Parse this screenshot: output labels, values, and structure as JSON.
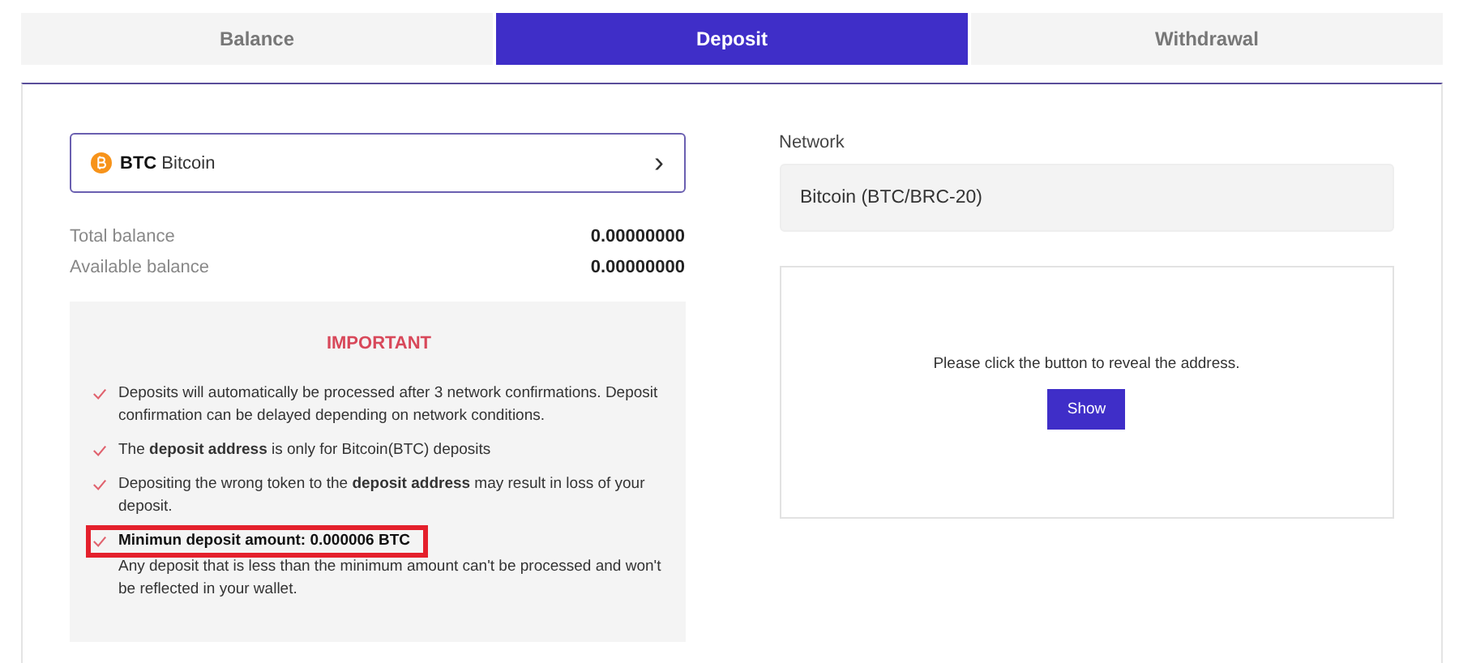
{
  "tabs": [
    {
      "label": "Balance",
      "selected": false
    },
    {
      "label": "Deposit",
      "selected": true
    },
    {
      "label": "Withdrawal",
      "selected": false
    }
  ],
  "coin_selector": {
    "symbol": "BTC",
    "name": "Bitcoin",
    "chevron": "›"
  },
  "balances": [
    {
      "label": "Total balance",
      "value": "0.00000000"
    },
    {
      "label": "Available balance",
      "value": "0.00000000"
    }
  ],
  "important": {
    "title": "IMPORTANT",
    "notes": [
      {
        "text": "Deposits will automatically be processed after 3 network confirmations. Deposit confirmation can be delayed depending on network conditions.",
        "highlighted": false
      },
      {
        "text": "The **deposit address** is only for Bitcoin(BTC) deposits",
        "highlighted": false
      },
      {
        "text": "Depositing the wrong token to the **deposit address** may result in loss of your deposit.",
        "highlighted": false
      },
      {
        "heading": "Minimun deposit amount: 0.000006 BTC",
        "text": "Any deposit that is less than the minimum amount can't be processed and won't be reflected in your wallet.",
        "highlighted": true
      }
    ]
  },
  "network": {
    "label": "Network",
    "value": "Bitcoin (BTC/BRC-20)"
  },
  "address": {
    "message": "Please click the button to reveal the address.",
    "button": "Show"
  }
}
